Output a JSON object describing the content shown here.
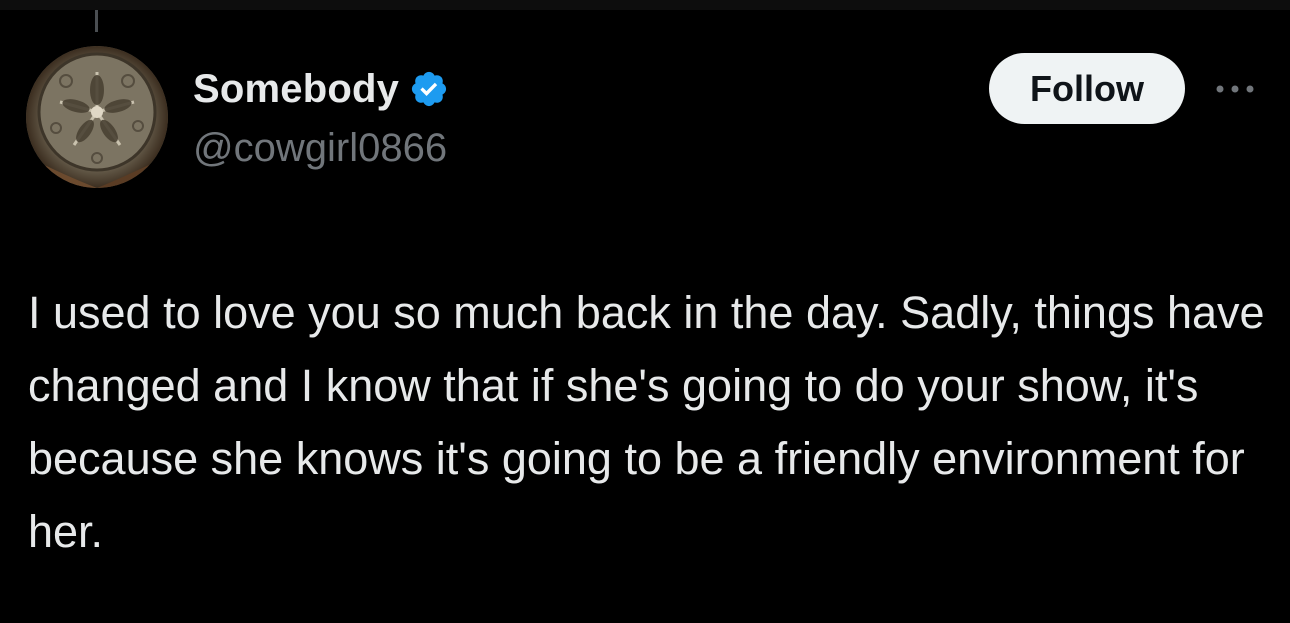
{
  "author": {
    "display_name": "Somebody",
    "handle": "@cowgirl0866",
    "verified": true,
    "verified_badge_color": "#1d9bf0",
    "avatar_icon": "sand-dollar-avatar"
  },
  "actions": {
    "follow_label": "Follow",
    "more_icon": "ellipsis-icon"
  },
  "tweet": {
    "text": "I used to love you so much back in the day. Sadly, things have changed and I know that if she's going to do your show, it's because she knows it's going to be a friendly environment for her."
  },
  "colors": {
    "background": "#000000",
    "text_primary": "#e7e9ea",
    "text_secondary": "#71767b",
    "button_bg": "#eff3f4",
    "button_text": "#0f1419"
  }
}
